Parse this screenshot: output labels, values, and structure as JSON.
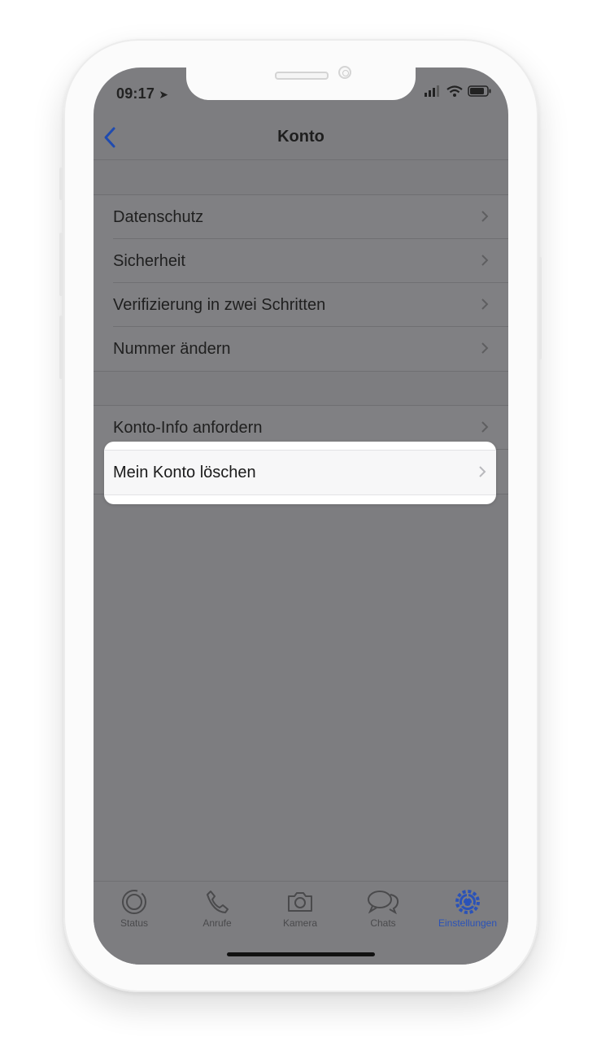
{
  "status_bar": {
    "time": "09:17"
  },
  "nav": {
    "title": "Konto"
  },
  "group1": [
    {
      "label": "Datenschutz"
    },
    {
      "label": "Sicherheit"
    },
    {
      "label": "Verifizierung in zwei Schritten"
    },
    {
      "label": "Nummer ändern"
    }
  ],
  "group2": [
    {
      "label": "Konto-Info anfordern"
    },
    {
      "label": "Mein Konto löschen"
    }
  ],
  "tabs": [
    {
      "label": "Status",
      "icon": "status-icon"
    },
    {
      "label": "Anrufe",
      "icon": "phone-icon"
    },
    {
      "label": "Kamera",
      "icon": "camera-icon"
    },
    {
      "label": "Chats",
      "icon": "chats-icon"
    },
    {
      "label": "Einstellungen",
      "icon": "gear-icon",
      "active": true
    }
  ],
  "colors": {
    "accent": "#2a52b8",
    "overlay": "#7d7d80"
  }
}
